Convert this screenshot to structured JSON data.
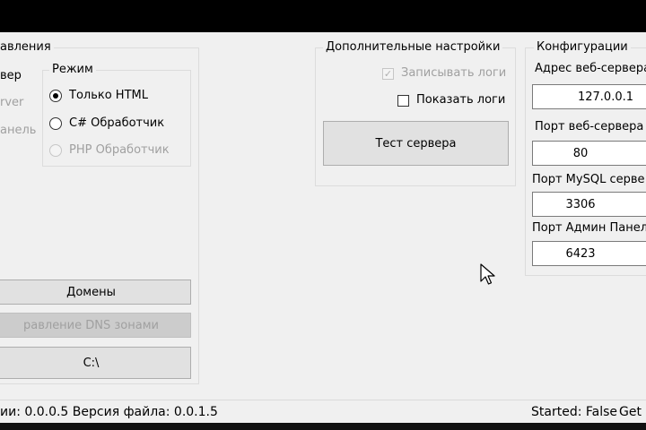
{
  "sections": {
    "management": "авления",
    "mode": "Режим",
    "additional": "Дополнительные настройки",
    "config": "Конфигурации"
  },
  "management": {
    "item1": "вер",
    "item2": "rver",
    "item3": "анель",
    "buttons": {
      "domains": "Домены",
      "dns": "равление DNS зонами",
      "path": "C:\\"
    }
  },
  "mode": {
    "html_only": "Только HTML",
    "csharp": "C# Обработчик",
    "php": "PHP Обработчик"
  },
  "additional": {
    "write_logs": "Записывать логи",
    "show_logs": "Показать логи",
    "test_button": "Тест сервера"
  },
  "config": {
    "web_address_label": "Адрес веб-сервера",
    "web_address_value": "127.0.0.1",
    "web_port_label": "Порт веб-сервера",
    "web_port_value": "80",
    "mysql_port_label": "Порт MySQL серве",
    "mysql_port_value": "3306",
    "admin_port_label": "Порт Админ Панел",
    "admin_port_value": "6423"
  },
  "status": {
    "version": "ии: 0.0.0.5 Версия файла: 0.0.1.5",
    "started": "Started: False",
    "get": "Get I"
  },
  "icons": {
    "cursor": "mouse-pointer-icon",
    "check": "checkmark-icon"
  }
}
